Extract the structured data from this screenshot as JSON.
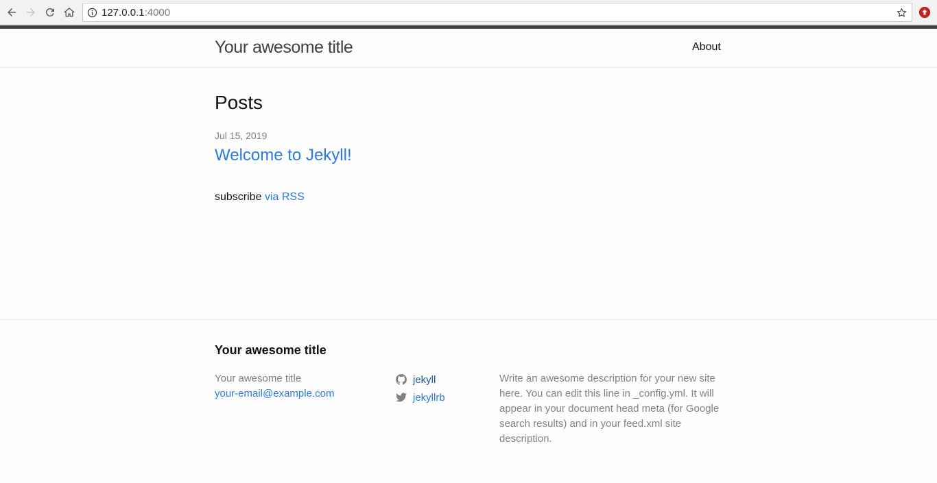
{
  "browser": {
    "url_host": "127.0.0.1",
    "url_port": ":4000"
  },
  "header": {
    "site_title": "Your awesome title",
    "nav_about": "About"
  },
  "main": {
    "heading": "Posts",
    "posts": [
      {
        "date": "Jul 15, 2019",
        "title": "Welcome to Jekyll!"
      }
    ],
    "rss_prefix": "subscribe",
    "rss_link": "via RSS"
  },
  "footer": {
    "heading": "Your awesome title",
    "name": "Your awesome title",
    "email": "your-email@example.com",
    "github": "jekyll",
    "twitter": "jekyllrb",
    "description": "Write an awesome description for your new site here. You can edit this line in _config.yml. It will appear in your document head meta (for Google search results) and in your feed.xml site description."
  },
  "colors": {
    "link": "#2a7ae2",
    "meta_text": "#828282",
    "accent_bar": "#424242"
  }
}
